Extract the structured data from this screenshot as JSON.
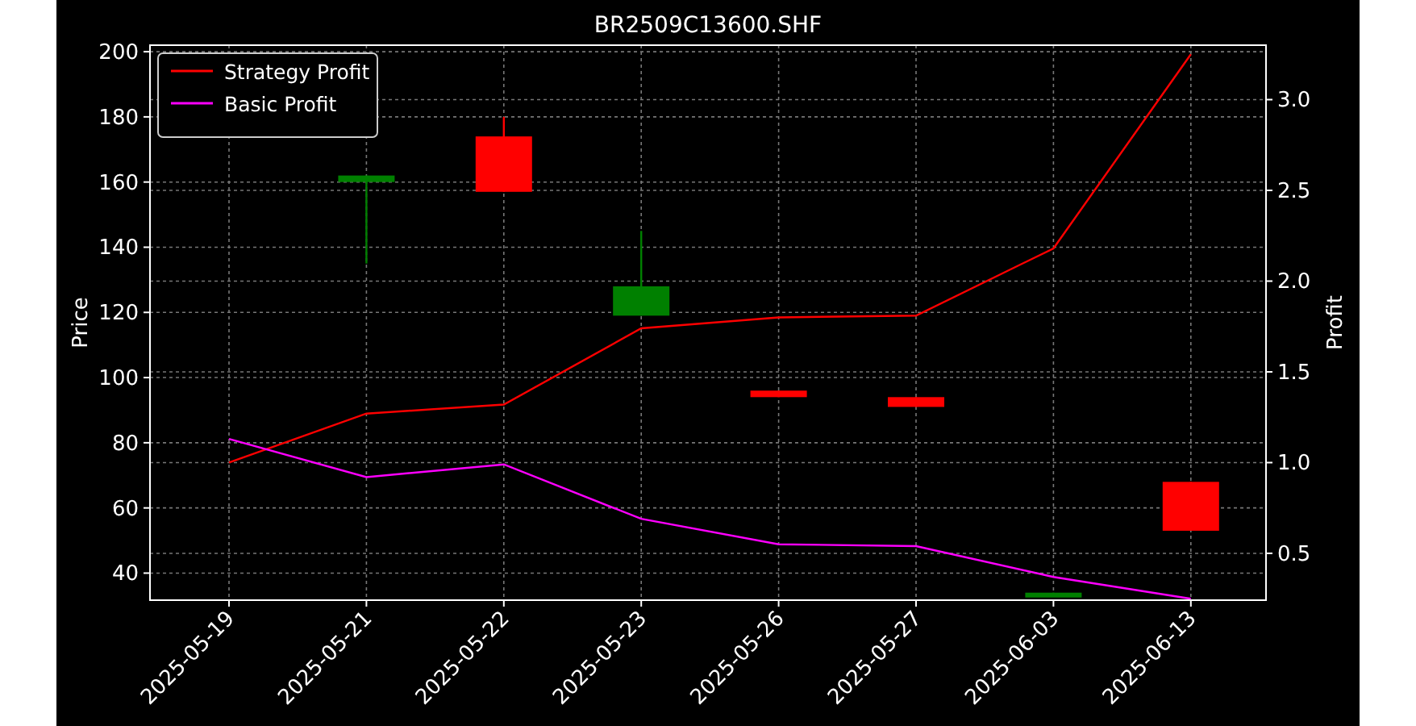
{
  "chart": {
    "chart_data": {
      "type": "line",
      "title": "BR2509C13600.SHF",
      "ylabel": "Price",
      "y2label": "Profit",
      "categories": [
        "2025-05-19",
        "2025-05-21",
        "2025-05-22",
        "2025-05-23",
        "2025-05-26",
        "2025-05-27",
        "2025-06-03",
        "2025-06-13"
      ],
      "grid": true,
      "legend": true,
      "ylim": [
        31.7,
        202
      ],
      "yticks": [
        40,
        60,
        80,
        100,
        120,
        140,
        160,
        180,
        200
      ],
      "y2lim": [
        0.242,
        3.3
      ],
      "y2ticks": [
        {
          "value": 0.5,
          "label": "0.5"
        },
        {
          "value": 1,
          "label": "1.0"
        },
        {
          "value": 1.5,
          "label": "1.5"
        },
        {
          "value": 2,
          "label": "2.0"
        },
        {
          "value": 2.5,
          "label": "2.5"
        },
        {
          "value": 3,
          "label": "3.0"
        }
      ],
      "series": [
        {
          "type": "candlestick",
          "ohlc": [
            null,
            [
              160,
              162,
              135,
              162
            ],
            [
              174,
              180,
              157,
              157
            ],
            [
              119,
              145,
              119,
              128
            ],
            [
              96,
              96,
              94,
              94
            ],
            [
              94,
              94,
              91,
              91
            ],
            [
              33,
              34,
              33,
              34
            ],
            [
              68,
              68,
              53,
              53
            ]
          ]
        },
        {
          "name": "Strategy Profit",
          "color": "#ff0000",
          "axis": "y2",
          "values": [
            1.0,
            1.27,
            1.32,
            1.74,
            1.8,
            1.81,
            2.18,
            3.25
          ]
        },
        {
          "name": "Basic Profit",
          "color": "#ff00ff",
          "axis": "y2",
          "values": [
            1.13,
            0.92,
            0.99,
            0.69,
            0.55,
            0.54,
            0.37,
            0.25
          ]
        }
      ]
    }
  }
}
